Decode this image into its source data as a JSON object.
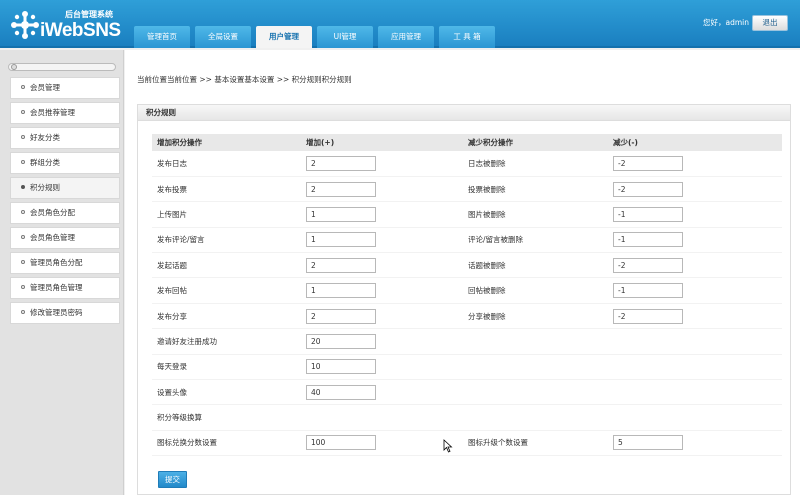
{
  "header": {
    "logo_subtitle": "后台管理系统",
    "logo_text": "iWebSNS",
    "greeting": "您好，admin",
    "logout_label": "退出",
    "nav": [
      {
        "label": "管理首页",
        "active": false
      },
      {
        "label": "全局设置",
        "active": false
      },
      {
        "label": "用户管理",
        "active": true
      },
      {
        "label": "UI管理",
        "active": false
      },
      {
        "label": "应用管理",
        "active": false
      },
      {
        "label": "工 具 箱",
        "active": false
      }
    ]
  },
  "sidebar": {
    "items": [
      {
        "label": "会员管理",
        "active": false
      },
      {
        "label": "会员推荐管理",
        "active": false
      },
      {
        "label": "好友分类",
        "active": false
      },
      {
        "label": "群组分类",
        "active": false
      },
      {
        "label": "积分规则",
        "active": true
      },
      {
        "label": "会员角色分配",
        "active": false
      },
      {
        "label": "会员角色管理",
        "active": false
      },
      {
        "label": "管理员角色分配",
        "active": false
      },
      {
        "label": "管理员角色管理",
        "active": false
      },
      {
        "label": "修改管理员密码",
        "active": false
      }
    ]
  },
  "breadcrumb": "当前位置当前位置 >> 基本设置基本设置 >> 积分规则积分规则",
  "panel": {
    "title": "积分规则",
    "headers": [
      "增加积分操作",
      "增加(+)",
      "减少积分操作",
      "减少(-)"
    ],
    "rows": [
      {
        "add_label": "发布日志",
        "add_value": "2",
        "sub_label": "日志被删除",
        "sub_value": "-2"
      },
      {
        "add_label": "发布投票",
        "add_value": "2",
        "sub_label": "投票被删除",
        "sub_value": "-2"
      },
      {
        "add_label": "上传图片",
        "add_value": "1",
        "sub_label": "图片被删除",
        "sub_value": "-1"
      },
      {
        "add_label": "发布评论/留言",
        "add_value": "1",
        "sub_label": "评论/留言被删除",
        "sub_value": "-1"
      },
      {
        "add_label": "发起话题",
        "add_value": "2",
        "sub_label": "话题被删除",
        "sub_value": "-2"
      },
      {
        "add_label": "发布回帖",
        "add_value": "1",
        "sub_label": "回帖被删除",
        "sub_value": "-1"
      },
      {
        "add_label": "发布分享",
        "add_value": "2",
        "sub_label": "分享被删除",
        "sub_value": "-2"
      },
      {
        "add_label": "邀请好友注册成功",
        "add_value": "20"
      },
      {
        "add_label": "每天登录",
        "add_value": "10"
      },
      {
        "add_label": "设置头像",
        "add_value": "40"
      }
    ],
    "section_label": "积分等级换算",
    "conversion": {
      "label_1": "图标兑换分数设置",
      "value_1": "100",
      "label_2": "图标升级个数设置",
      "value_2": "5"
    },
    "submit_label": "提交"
  }
}
